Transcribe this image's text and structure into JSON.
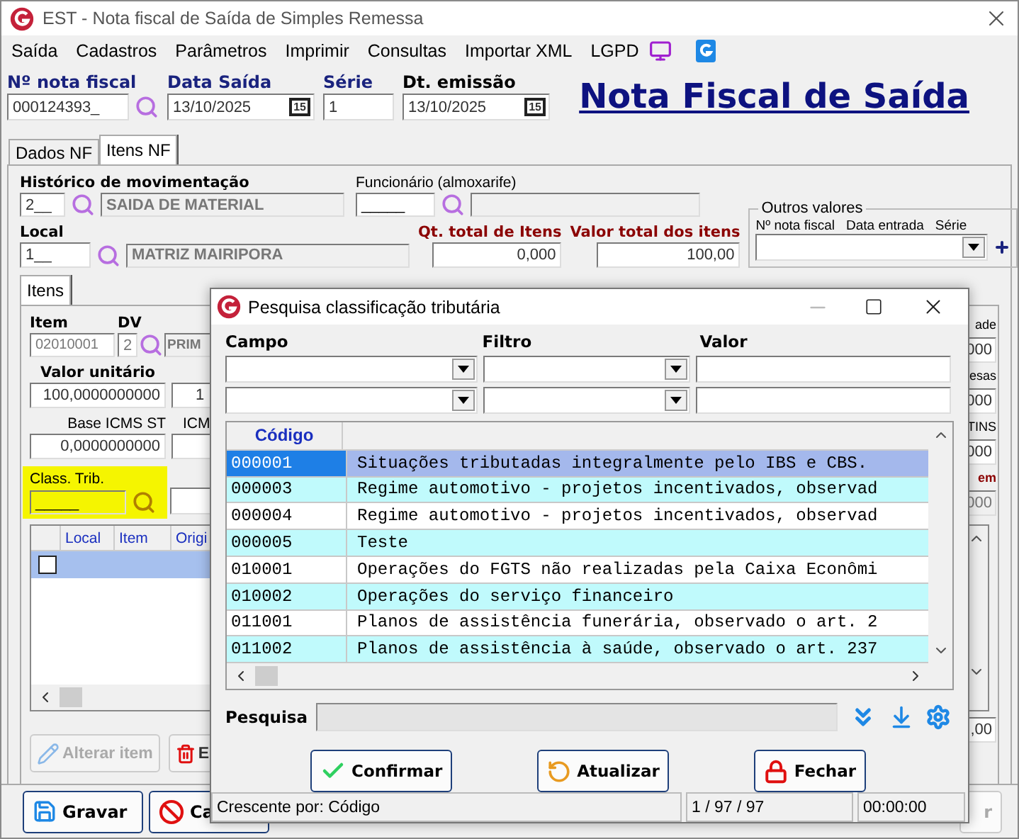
{
  "window": {
    "title": "EST - Nota fiscal de Saída de Simples Remessa"
  },
  "menu": [
    "Saída",
    "Cadastros",
    "Parâmetros",
    "Imprimir",
    "Consultas",
    "Importar XML",
    "LGPD"
  ],
  "header_fields": [
    {
      "label": "Nº nota fiscal",
      "value": "000124393_",
      "kind": "search"
    },
    {
      "label": "Data Saída",
      "value": "13/10/2025",
      "kind": "date",
      "button": "15"
    },
    {
      "label": "Série",
      "value": "1",
      "kind": "text"
    },
    {
      "label": "Dt. emissão",
      "value": "13/10/2025",
      "kind": "date",
      "button": "15"
    }
  ],
  "page_heading": "Nota Fiscal de Saída",
  "tabs": [
    {
      "label": "Dados NF",
      "selected": false
    },
    {
      "label": "Itens NF",
      "selected": true
    }
  ],
  "historico": {
    "label": "Histórico de movimentação",
    "code": "2__",
    "description": "SAIDA DE MATERIAL"
  },
  "funcionario": {
    "label": "Funcionário (almoxarife)",
    "code": "_____"
  },
  "local": {
    "label": "Local",
    "code": "1__",
    "description": "MATRIZ MAIRIPORA"
  },
  "totals": [
    {
      "label": "Qt. total de Itens",
      "value": "0,000"
    },
    {
      "label": "Valor total dos itens",
      "value": "100,00"
    }
  ],
  "outros_valores": {
    "title": "Outros valores",
    "columns": [
      "Nº nota fiscal",
      "Data entrada",
      "Série"
    ]
  },
  "inner_tabs": [
    {
      "label": "Itens",
      "selected": true
    }
  ],
  "item": {
    "item_label": "Item",
    "item_value": "02010001",
    "dv_label": "DV",
    "dv_value": "2",
    "description": "PRIM"
  },
  "valor_unitario": {
    "label": "Valor unitário",
    "value": "100,0000000000",
    "next_value": "1"
  },
  "base_icms_st": {
    "label": "Base ICMS ST",
    "value": "0,0000000000",
    "next_label": "ICM"
  },
  "class_trib": {
    "label": "Class. Trib.",
    "value": "_____"
  },
  "side_fields": [
    {
      "label": "ade",
      "value": "000",
      "disabled": false,
      "emphasis": false
    },
    {
      "label": "esas",
      "value": "000",
      "disabled": false,
      "emphasis": false
    },
    {
      "label": "TINS",
      "value": "000",
      "disabled": false,
      "emphasis": false
    },
    {
      "label": "em",
      "value": "000",
      "disabled": true,
      "emphasis": true
    }
  ],
  "items_grid": {
    "columns": [
      "Local",
      "Item",
      "Origi"
    ],
    "rows": [
      {
        "selected": true,
        "checked": false
      }
    ]
  },
  "grid_total": ",00",
  "item_buttons": [
    {
      "label": "Alterar item",
      "disabled": true
    },
    {
      "label": "E",
      "disabled": false
    }
  ],
  "bottom_buttons": [
    "Gravar",
    "Ca"
  ],
  "bottom_right_button": "r",
  "dialog": {
    "title": "Pesquisa classificação tributária",
    "filter_labels": [
      "Campo",
      "Filtro",
      "Valor"
    ],
    "code_column": "Código",
    "rows": [
      {
        "code": "000001",
        "description": "Situações tributadas integralmente pelo IBS e CBS.",
        "selected": true
      },
      {
        "code": "000003",
        "description": "Regime automotivo - projetos incentivados, observad",
        "selected": false
      },
      {
        "code": "000004",
        "description": "Regime automotivo - projetos incentivados, observad",
        "selected": false
      },
      {
        "code": "000005",
        "description": "Teste",
        "selected": false
      },
      {
        "code": "010001",
        "description": "Operações do FGTS não realizadas pela Caixa Econômi",
        "selected": false
      },
      {
        "code": "010002",
        "description": "Operações do serviço financeiro",
        "selected": false
      },
      {
        "code": "011001",
        "description": "Planos de assistência funerária, observado o art. 2",
        "selected": false
      },
      {
        "code": "011002",
        "description": "Planos de assistência à saúde, observado o art. 237",
        "selected": false
      }
    ],
    "search_label": "Pesquisa",
    "buttons": [
      "Confirmar",
      "Atualizar",
      "Fechar"
    ],
    "status": [
      "Crescente por: Código",
      "1 / 97 / 97",
      "00:00:00"
    ]
  }
}
